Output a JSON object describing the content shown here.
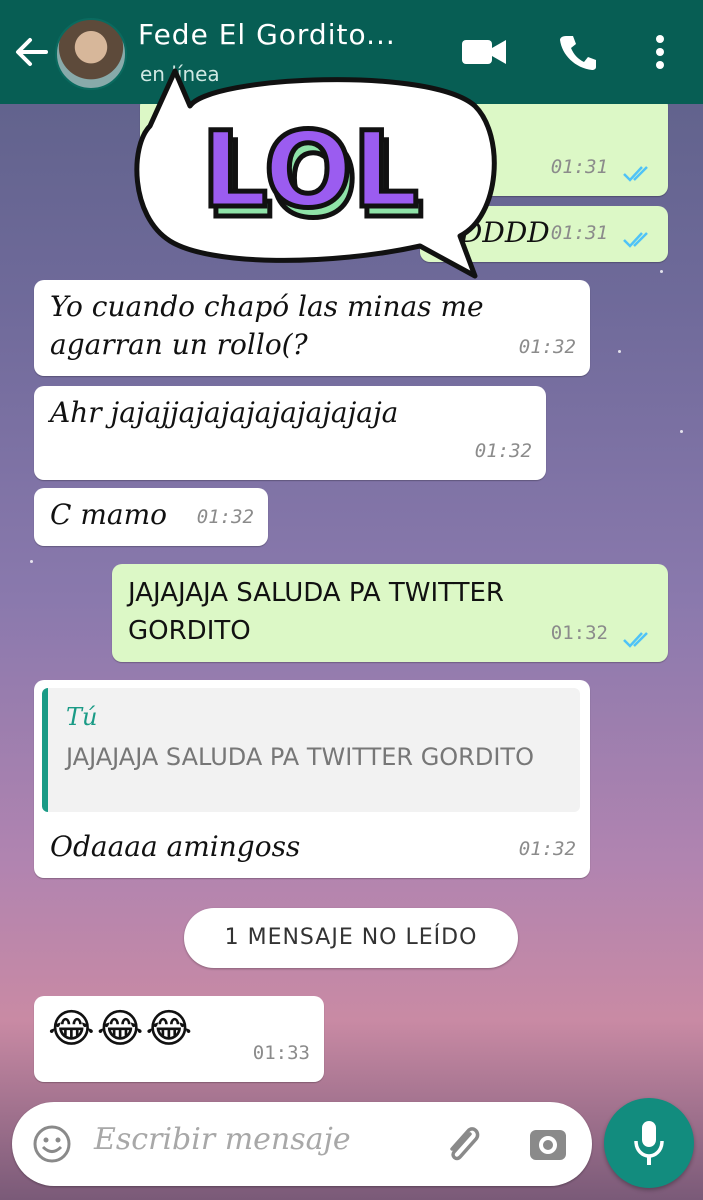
{
  "header": {
    "contact_name": "Fede El Gordito...",
    "status": "en línea"
  },
  "sticker": {
    "text": "LOL"
  },
  "messages": [
    {
      "side": "out",
      "text": "",
      "time": "01:31",
      "ticks": "read"
    },
    {
      "side": "out",
      "text": "XDDDD",
      "time": "01:31",
      "ticks": "read"
    },
    {
      "side": "in",
      "text": "Yo cuando chapó las minas me agarran un rollo(?",
      "time": "01:32"
    },
    {
      "side": "in",
      "text": "Ahr jajajjajajajajajajajaja",
      "time": "01:32"
    },
    {
      "side": "in",
      "text": "C mamo",
      "time": "01:32"
    },
    {
      "side": "out",
      "text": "JAJAJAJA SALUDA PA TWITTER GORDITO",
      "time": "01:32",
      "ticks": "read"
    },
    {
      "side": "in",
      "reply_to": {
        "author": "Tú",
        "text": "JAJAJAJA SALUDA PA TWITTER GORDITO"
      },
      "text": "Odaaaa amingoss",
      "time": "01:32"
    },
    {
      "side": "in",
      "text": "😂😂😂",
      "time": "01:33"
    }
  ],
  "unread_banner": "1 MENSAJE NO LEÍDO",
  "composer": {
    "placeholder": "Escribir mensaje"
  },
  "colors": {
    "header": "#075e54",
    "outgoing": "#dcf8c6",
    "accent": "#128c7e",
    "read_ticks": "#4fc3f7"
  }
}
